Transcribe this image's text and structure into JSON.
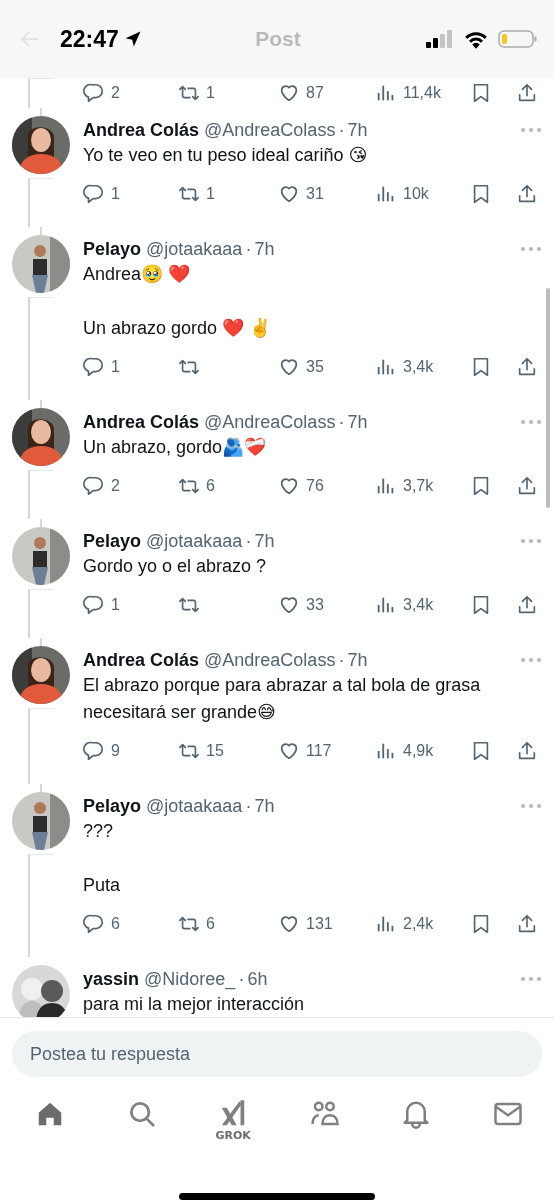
{
  "status_bar": {
    "time": "22:47"
  },
  "header": {
    "title": "Post"
  },
  "partial_actions": {
    "replies": "2",
    "reposts": "1",
    "likes": "87",
    "views": "11,4k"
  },
  "tweets": [
    {
      "name": "Andrea Colás",
      "handle": "@AndreaColass",
      "separator": "·",
      "time": "7h",
      "paragraphs": [
        "Yo te veo en tu peso ideal cariño 😘"
      ],
      "stats": {
        "replies": "1",
        "reposts": "1",
        "likes": "31",
        "views": "10k"
      }
    },
    {
      "name": "Pelayo",
      "handle": "@jotaakaaa",
      "separator": "·",
      "time": "7h",
      "paragraphs": [
        "Andrea🥹 ❤️",
        "Un abrazo gordo ❤️ ✌️"
      ],
      "stats": {
        "replies": "1",
        "likes": "35",
        "views": "3,4k"
      }
    },
    {
      "name": "Andrea Colás",
      "handle": "@AndreaColass",
      "separator": "·",
      "time": "7h",
      "paragraphs": [
        "Un abrazo, gordo🫂❤️‍🩹"
      ],
      "stats": {
        "replies": "2",
        "reposts": "6",
        "likes": "76",
        "views": "3,7k"
      }
    },
    {
      "name": "Pelayo",
      "handle": "@jotaakaaa",
      "separator": "·",
      "time": "7h",
      "paragraphs": [
        "Gordo yo o el abrazo ?"
      ],
      "stats": {
        "replies": "1",
        "likes": "33",
        "views": "3,4k"
      }
    },
    {
      "name": "Andrea Colás",
      "handle": "@AndreaColass",
      "separator": "·",
      "time": "7h",
      "paragraphs": [
        "El abrazo porque para abrazar a tal bola de grasa necesitará ser grande😅"
      ],
      "stats": {
        "replies": "9",
        "reposts": "15",
        "likes": "117",
        "views": "4,9k"
      }
    },
    {
      "name": "Pelayo",
      "handle": "@jotaakaaa",
      "separator": "·",
      "time": "7h",
      "paragraphs": [
        "???",
        "Puta"
      ],
      "stats": {
        "replies": "6",
        "reposts": "6",
        "likes": "131",
        "views": "2,4k"
      }
    },
    {
      "name": "yassin",
      "handle": "@Nidoree_",
      "separator": "·",
      "time": "6h",
      "paragraphs": [
        "para mi la mejor interacción"
      ]
    }
  ],
  "reply_field": {
    "placeholder": "Postea tu respuesta"
  },
  "nav": [
    {
      "kind": "home",
      "selected": true
    },
    {
      "kind": "search",
      "selected": false
    },
    {
      "kind": "grok",
      "label": "GROK",
      "selected": false
    },
    {
      "kind": "communities",
      "selected": false
    },
    {
      "kind": "notifications",
      "selected": false
    },
    {
      "kind": "messages",
      "selected": false
    }
  ]
}
